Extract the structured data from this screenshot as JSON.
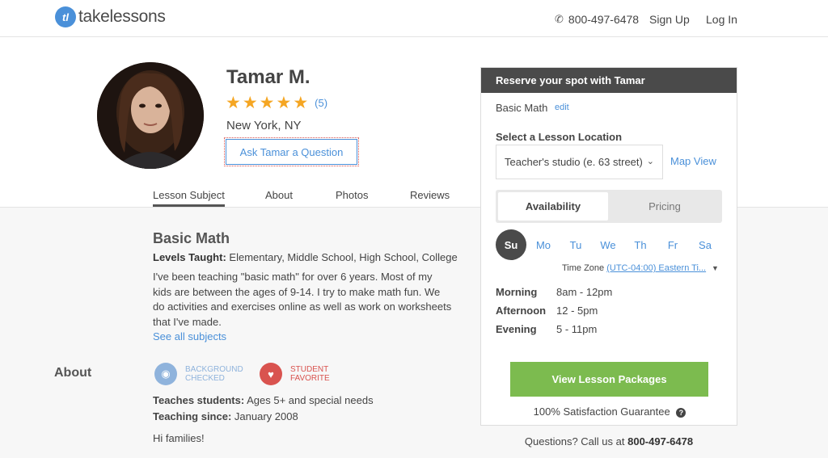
{
  "header": {
    "logo_text": "takelessons",
    "phone": "800-497-6478",
    "signup": "Sign Up",
    "login": "Log In"
  },
  "profile": {
    "name": "Tamar M.",
    "rating_stars": 5,
    "review_count": "(5)",
    "location": "New York, NY",
    "ask_button": "Ask Tamar a Question"
  },
  "tabs": [
    "Lesson Subject",
    "About",
    "Photos",
    "Reviews"
  ],
  "subject": {
    "title": "Basic Math",
    "levels_label": "Levels Taught:",
    "levels_value": "Elementary, Middle School, High School, College",
    "description": "I've been teaching \"basic math\" for over 6 years. Most of my kids are between the ages of 9-14. I try to make math fun. We do activities and exercises online as well as work on worksheets that I've made.",
    "see_all": "See all subjects"
  },
  "about": {
    "heading": "About",
    "badge1": "BACKGROUND CHECKED",
    "badge2": "STUDENT FAVORITE",
    "teaches_label": "Teaches students:",
    "teaches_value": "Ages 5+ and special needs",
    "since_label": "Teaching since:",
    "since_value": "January 2008",
    "intro": "Hi families!"
  },
  "reserve": {
    "title": "Reserve your spot with Tamar",
    "subject": "Basic Math",
    "edit": "edit",
    "location_label": "Select a Lesson Location",
    "location_value": "Teacher's studio (e. 63 street)",
    "map_view": "Map View",
    "availability": "Availability",
    "pricing": "Pricing",
    "days": [
      "Su",
      "Mo",
      "Tu",
      "We",
      "Th",
      "Fr",
      "Sa"
    ],
    "selected_day": "Su",
    "timezone_label": "Time Zone",
    "timezone_value": "(UTC-04:00) Eastern Ti...",
    "slots": [
      {
        "label": "Morning",
        "time": "8am - 12pm"
      },
      {
        "label": "Afternoon",
        "time": "12 - 5pm"
      },
      {
        "label": "Evening",
        "time": "5 - 11pm"
      }
    ],
    "cta": "View Lesson Packages",
    "guarantee": "100% Satisfaction Guarantee",
    "questions": "Questions? Call us at",
    "questions_phone": "800-497-6478"
  },
  "colors": {
    "accent": "#4a90d9",
    "star": "#f5a623",
    "cta": "#7cbb4f",
    "panel_head": "#4a4a4a",
    "badge_bg": "#8fb3dc",
    "badge_fav": "#d9534f"
  }
}
